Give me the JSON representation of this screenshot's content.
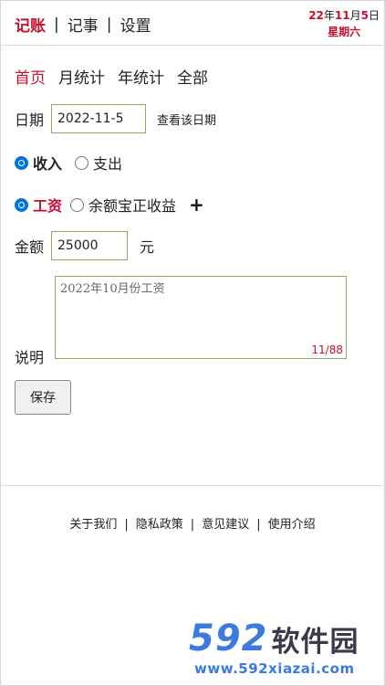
{
  "header": {
    "nav": [
      "记账",
      "记事",
      "设置"
    ],
    "date_year": "22",
    "date_year_unit": "年",
    "date_month": "11",
    "date_month_unit": "月",
    "date_day": "5",
    "date_day_unit": "日",
    "weekday": "星期六"
  },
  "tabs": [
    "首页",
    "月统计",
    "年统计",
    "全部"
  ],
  "form": {
    "date_label": "日期",
    "date_value": "2022-11-5",
    "view_date_link": "查看该日期",
    "type_options": [
      "收入",
      "支出"
    ],
    "type_selected": "收入",
    "category_options": [
      "工资",
      "余额宝正收益"
    ],
    "category_selected": "工资",
    "add_category": "+",
    "amount_label": "金额",
    "amount_value": "25000",
    "amount_unit": "元",
    "desc_label": "说明",
    "desc_value": "2022年10月份工资",
    "desc_count": "11/88",
    "save_label": "保存"
  },
  "footer": {
    "links": [
      "关于我们",
      "隐私政策",
      "意见建议",
      "使用介绍"
    ],
    "separator": "|"
  },
  "watermark": {
    "logo_number": "592",
    "logo_text": "软件园",
    "url": "www.592xiazai.com"
  },
  "colors": {
    "accent": "#c8102e",
    "radio": "#0075d9",
    "input_border": "#8aa96a",
    "watermark_blue": "#3b7be0"
  }
}
